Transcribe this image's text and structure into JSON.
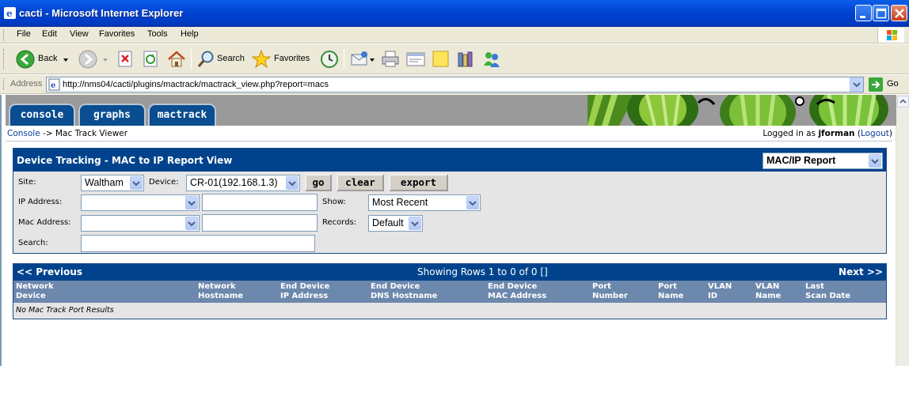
{
  "window": {
    "title": "cacti - Microsoft Internet Explorer"
  },
  "menu": [
    "File",
    "Edit",
    "View",
    "Favorites",
    "Tools",
    "Help"
  ],
  "toolbar": {
    "back": "Back",
    "search": "Search",
    "favorites": "Favorites"
  },
  "address": {
    "label": "Address",
    "url": "http://nms04/cacti/plugins/mactrack/mactrack_view.php?report=macs",
    "go": "Go"
  },
  "tabs": [
    "console",
    "graphs",
    "mactrack"
  ],
  "breadcrumb": {
    "console": "Console",
    "sep": "->",
    "current": "Mac Track Viewer"
  },
  "login": {
    "prefix": "Logged in as",
    "user": "jforman",
    "logout": "Logout"
  },
  "filter": {
    "title": "Device Tracking - MAC to IP Report View",
    "report_select": "MAC/IP Report",
    "site_label": "Site:",
    "site_value": "Waltham",
    "device_label": "Device:",
    "device_value": "CR-01(192.168.1.3)",
    "go": "go",
    "clear": "clear",
    "export": "export",
    "ip_label": "IP Address:",
    "show_label": "Show:",
    "show_value": "Most Recent",
    "mac_label": "Mac Address:",
    "records_label": "Records:",
    "records_value": "Default",
    "search_label": "Search:"
  },
  "results": {
    "prev": "<< Previous",
    "showing": "Showing Rows 1 to 0 of 0 []",
    "next": "Next >>",
    "columns": [
      [
        "Network",
        "Device"
      ],
      [
        "Network",
        "Hostname"
      ],
      [
        "End Device",
        "IP Address"
      ],
      [
        "End Device",
        "DNS Hostname"
      ],
      [
        "End Device",
        "MAC Address"
      ],
      [
        "Port",
        "Number"
      ],
      [
        "Port",
        "Name"
      ],
      [
        "VLAN",
        "ID"
      ],
      [
        "VLAN",
        "Name"
      ],
      [
        "Last",
        "Scan Date"
      ]
    ],
    "empty": "No Mac Track Port Results"
  }
}
